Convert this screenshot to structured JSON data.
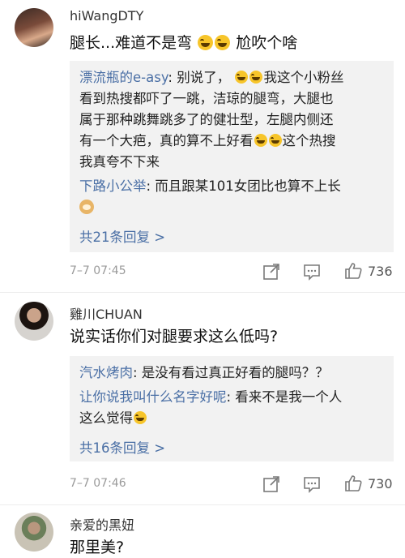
{
  "comments": [
    {
      "username": "hiWangDTY",
      "content_a": "腿长...难道不是弯",
      "content_b": "尬吹个啥",
      "replies": [
        {
          "name": "漂流瓶的e-asy",
          "text_1": ": 别说了，",
          "text_2": "我这个小粉丝",
          "text_3": "看到热搜都吓了一跳，洁琼的腿弯，大腿也",
          "text_4": "属于那种跳舞跳多了的健壮型，左腿内侧还",
          "text_5": "有一个大疤，真的算不上好看",
          "text_6": "这个热搜",
          "text_7": "我真夸不下来"
        },
        {
          "name": "下路小公举",
          "text_1": ": 而且跟某101女团比也算不上长"
        }
      ],
      "more_replies": "共21条回复 >",
      "time": "7–7 07:45",
      "likes": "736"
    },
    {
      "username": "雞川CHUAN",
      "content_a": "说实话你们对腿要求这么低吗?",
      "replies": [
        {
          "name": "汽水烤肉",
          "text_1": ": 是没有看过真正好看的腿吗？？"
        },
        {
          "name": "让你说我叫什么名字好呢",
          "text_1": ": 看来不是我一个人",
          "text_2": "这么觉得"
        }
      ],
      "more_replies": "共16条回复 >",
      "time": "7–7 07:46",
      "likes": "730"
    },
    {
      "username": "亲爱的黑妞",
      "content_a": "那里美?"
    }
  ],
  "icons": {
    "share": "share-icon",
    "comment": "comment-icon",
    "like": "thumbs-up-icon",
    "laugh_emoji": "laugh-cry-emoji-icon",
    "doge_emoji": "doge-emoji-icon"
  },
  "colors": {
    "link_blue": "#4a6fa5",
    "reply_bg": "#f2f2f2",
    "meta_gray": "#9a9a9a"
  }
}
